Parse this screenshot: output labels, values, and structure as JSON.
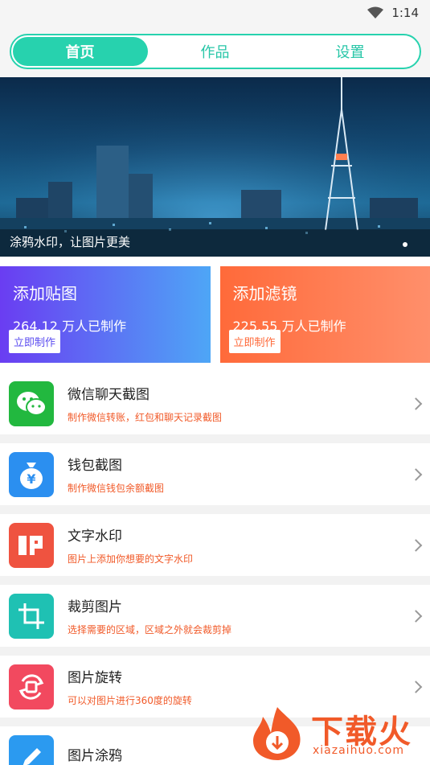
{
  "status": {
    "time": "1:14",
    "wifi_icon": "wifi-icon"
  },
  "tabs": [
    {
      "label": "首页",
      "active": true
    },
    {
      "label": "作品",
      "active": false
    },
    {
      "label": "设置",
      "active": false
    }
  ],
  "banner": {
    "caption": "涂鸦水印，让图片更美"
  },
  "cards": {
    "sticker": {
      "title": "添加贴图",
      "count": "264.12 万人已制作",
      "button": "立即制作"
    },
    "filter": {
      "title": "添加滤镜",
      "count": "225.55 万人已制作",
      "button": "立即制作"
    }
  },
  "items": [
    {
      "title": "微信聊天截图",
      "sub": "制作微信转账，红包和聊天记录截图",
      "icon": "wechat-icon",
      "color": "#22b83f"
    },
    {
      "title": "钱包截图",
      "sub": "制作微信钱包余额截图",
      "icon": "money-bag-icon",
      "color": "#2b8ff0"
    },
    {
      "title": "文字水印",
      "sub": "图片上添加你想要的文字水印",
      "icon": "stamp-icon",
      "color": "#ef5340"
    },
    {
      "title": "裁剪图片",
      "sub": "选择需要的区域，区域之外就会裁剪掉",
      "icon": "crop-icon",
      "color": "#1fc1b3"
    },
    {
      "title": "图片旋转",
      "sub": "可以对图片进行360度的旋转",
      "icon": "rotate-icon",
      "color": "#f2495f"
    },
    {
      "title": "图片涂鸦",
      "sub": "",
      "icon": "pen-icon",
      "color": "#2b9af0"
    }
  ],
  "watermark": {
    "logo_text": "下载火",
    "url": "xiazaihuo.com"
  }
}
